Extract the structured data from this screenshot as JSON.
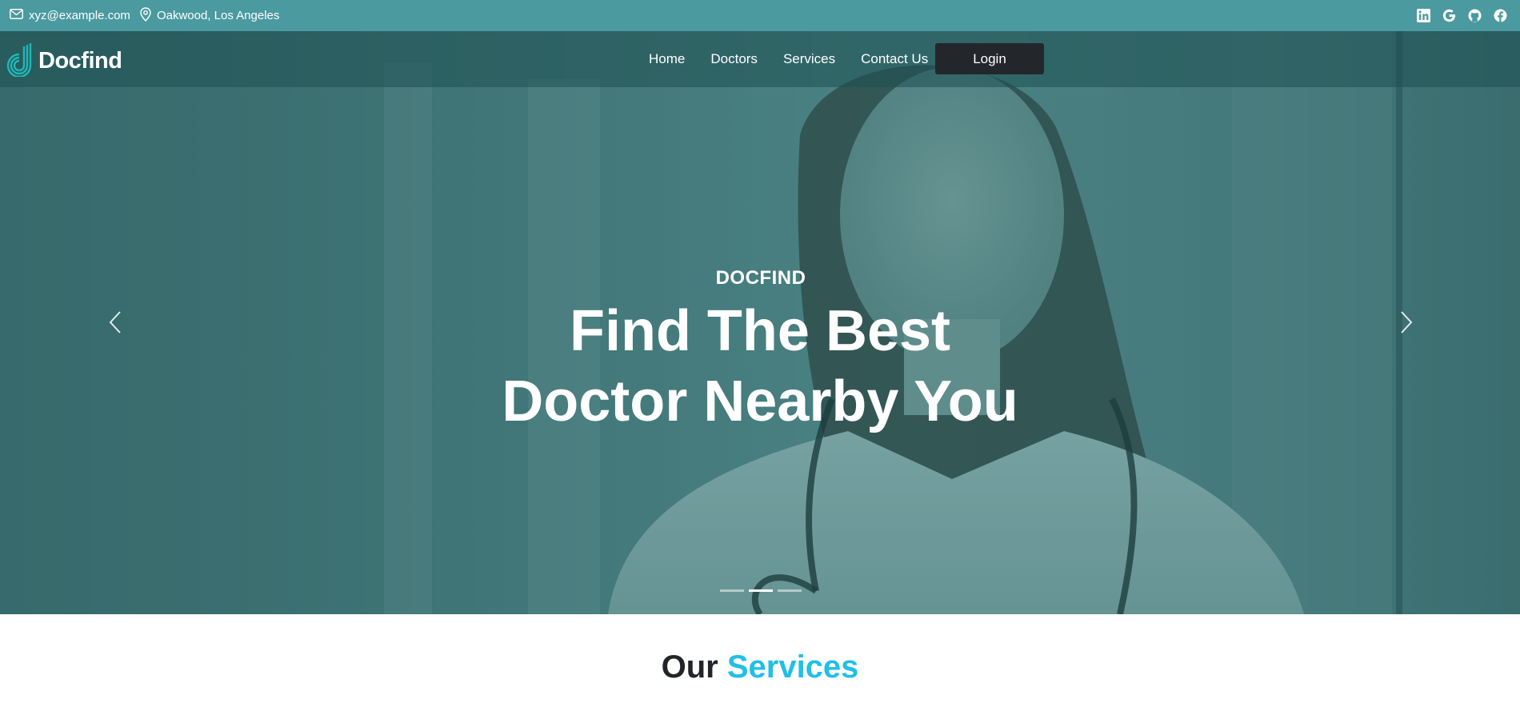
{
  "topbar": {
    "email": "xyz@example.com",
    "location": "Oakwood, Los Angeles",
    "social_icons": [
      "linkedin-icon",
      "google-icon",
      "github-icon",
      "facebook-icon"
    ]
  },
  "nav": {
    "brand": "Docfind",
    "links": [
      "Home",
      "Doctors",
      "Services",
      "Contact Us"
    ],
    "login": "Login"
  },
  "hero": {
    "eyebrow": "DOCFIND",
    "title_line1": "Find The Best",
    "title_line2": "Doctor Nearby You",
    "slides_total": 3,
    "active_slide": 2
  },
  "services": {
    "heading_part1": "Our",
    "heading_part2": "Services"
  },
  "colors": {
    "topbar": "#4a9aa0",
    "accent": "#22bfe6",
    "login_bg": "#23272b",
    "logo_teal": "#1fb8b8"
  }
}
